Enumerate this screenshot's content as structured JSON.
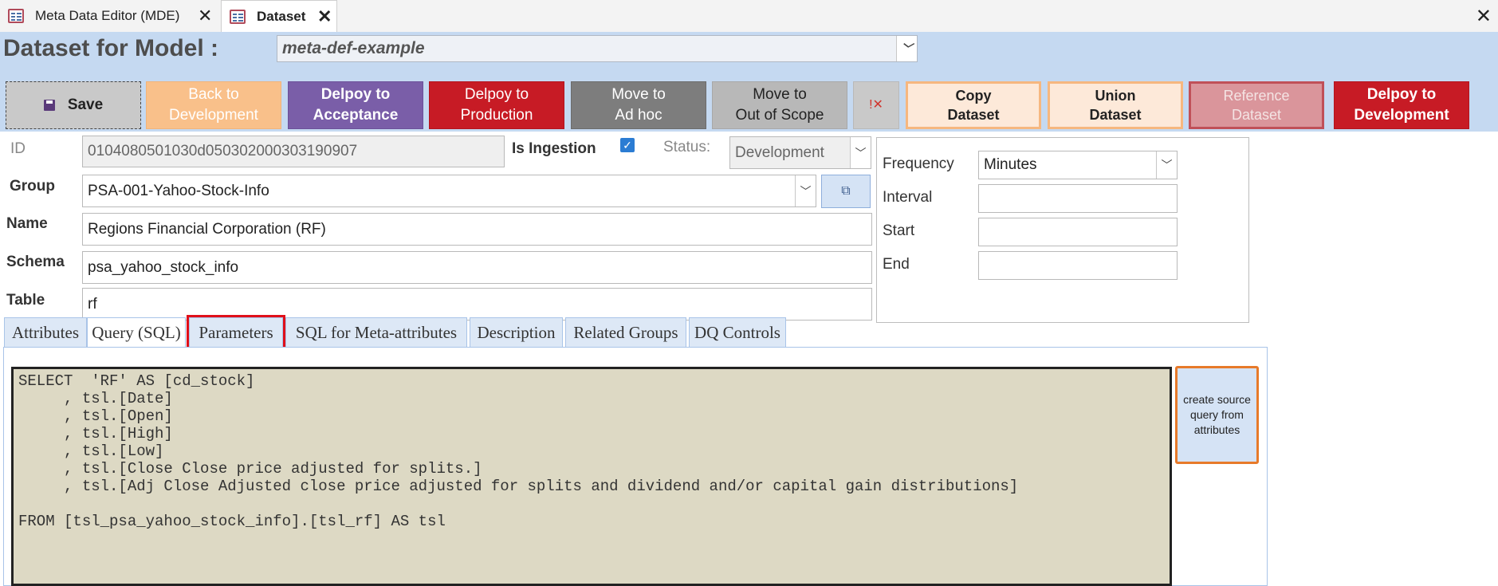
{
  "doc_tabs": [
    {
      "label": "Meta Data Editor (MDE)"
    },
    {
      "label": "Dataset"
    }
  ],
  "header": {
    "title": "Dataset for Model :",
    "model_value": "meta-def-example"
  },
  "toolbar": {
    "save": "Save",
    "back_dev": "Back to\nDevelopment",
    "acceptance": "Delpoy to\nAcceptance",
    "production": "Delpoy to\nProduction",
    "adhoc": "Move to\nAd hoc",
    "out_of_scope": "Move to\nOut of Scope",
    "copy": "Copy\nDataset",
    "union": "Union\nDataset",
    "reference": "Reference\nDataset",
    "deploy_dev": "Delpoy to\nDevelopment"
  },
  "form": {
    "id_label": "ID",
    "id_value": "0104080501030d050302000303190907",
    "ingestion_label": "Is Ingestion",
    "ingestion_checked": true,
    "status_label": "Status:",
    "status_value": "Development",
    "group_label": "Group",
    "group_value": "PSA-001-Yahoo-Stock-Info",
    "name_label": "Name",
    "name_value": "Regions Financial Corporation (RF)",
    "schema_label": "Schema",
    "schema_value": "psa_yahoo_stock_info",
    "table_label": "Table",
    "table_value": "rf"
  },
  "schedule": {
    "frequency_label": "Frequency",
    "frequency_value": "Minutes",
    "interval_label": "Interval",
    "interval_value": "",
    "start_label": "Start",
    "start_value": "",
    "end_label": "End",
    "end_value": ""
  },
  "form_tabs": [
    {
      "label": "Attributes"
    },
    {
      "label": "Query (SQL)"
    },
    {
      "label": "Parameters"
    },
    {
      "label": "SQL for Meta-attributes"
    },
    {
      "label": "Description"
    },
    {
      "label": "Related Groups"
    },
    {
      "label": "DQ Controls"
    }
  ],
  "active_tab": "Query (SQL)",
  "highlighted_tab": "Parameters",
  "sql": "SELECT  'RF' AS [cd_stock]\n     , tsl.[Date]\n     , tsl.[Open]\n     , tsl.[High]\n     , tsl.[Low]\n     , tsl.[Close Close price adjusted for splits.]\n     , tsl.[Adj Close Adjusted close price adjusted for splits and dividend and/or capital gain distributions]\n\nFROM [tsl_psa_yahoo_stock_info].[tsl_rf] AS tsl",
  "create_source_button": "create source\nquery from\nattributes"
}
